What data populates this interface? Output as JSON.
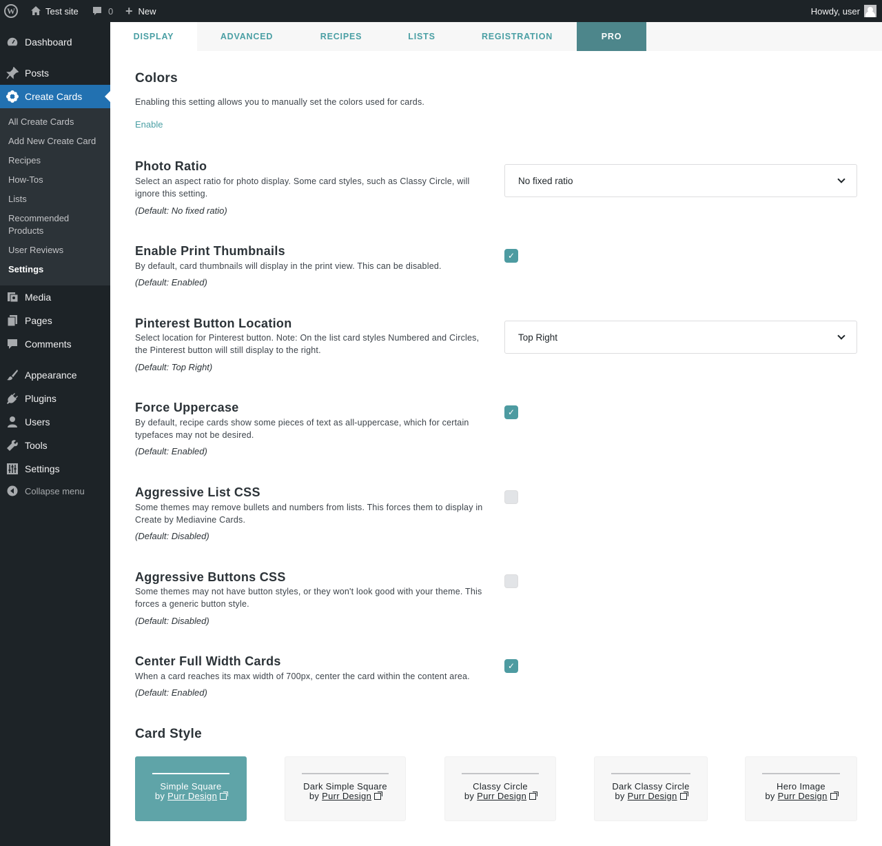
{
  "adminbar": {
    "site": "Test site",
    "comments_count": "0",
    "new": "New",
    "howdy": "Howdy, user"
  },
  "sidebar": {
    "items": [
      {
        "label": "Dashboard",
        "icon": "dashboard-icon"
      },
      {
        "label": "Posts",
        "icon": "pin-icon"
      },
      {
        "label": "Create Cards",
        "icon": "flower-icon"
      },
      {
        "label": "Media",
        "icon": "media-icon"
      },
      {
        "label": "Pages",
        "icon": "pages-icon"
      },
      {
        "label": "Comments",
        "icon": "comment-icon"
      },
      {
        "label": "Appearance",
        "icon": "brush-icon"
      },
      {
        "label": "Plugins",
        "icon": "plug-icon"
      },
      {
        "label": "Users",
        "icon": "user-icon"
      },
      {
        "label": "Tools",
        "icon": "wrench-icon"
      },
      {
        "label": "Settings",
        "icon": "sliders-icon"
      }
    ],
    "submenu": [
      "All Create Cards",
      "Add New Create Card",
      "Recipes",
      "How-Tos",
      "Lists",
      "Recommended Products",
      "User Reviews",
      "Settings"
    ],
    "collapse": "Collapse menu"
  },
  "tabs": [
    "DISPLAY",
    "ADVANCED",
    "RECIPES",
    "LISTS",
    "REGISTRATION",
    "PRO"
  ],
  "colors": {
    "title": "Colors",
    "desc": "Enabling this setting allows you to manually set the colors used for cards.",
    "link": "Enable"
  },
  "settings": {
    "photo_ratio": {
      "title": "Photo Ratio",
      "desc": "Select an aspect ratio for photo display. Some card styles, such as Classy Circle, will ignore this setting.",
      "default": "(Default: No fixed ratio)",
      "value": "No fixed ratio"
    },
    "print_thumbs": {
      "title": "Enable Print Thumbnails",
      "desc": "By default, card thumbnails will display in the print view. This can be disabled.",
      "default": "(Default: Enabled)",
      "checked": true
    },
    "pinterest": {
      "title": "Pinterest Button Location",
      "desc": "Select location for Pinterest button. Note: On the list card styles Numbered and Circles, the Pinterest button will still display to the right.",
      "default": "(Default: Top Right)",
      "value": "Top Right"
    },
    "uppercase": {
      "title": "Force Uppercase",
      "desc": "By default, recipe cards show some pieces of text as all-uppercase, which for certain typefaces may not be desired.",
      "default": "(Default: Enabled)",
      "checked": true
    },
    "list_css": {
      "title": "Aggressive List CSS",
      "desc": "Some themes may remove bullets and numbers from lists. This forces them to display in Create by Mediavine Cards.",
      "default": "(Default: Disabled)",
      "checked": false
    },
    "buttons_css": {
      "title": "Aggressive Buttons CSS",
      "desc": "Some themes may not have button styles, or they won't look good with your theme. This forces a generic button style.",
      "default": "(Default: Disabled)",
      "checked": false
    },
    "center_cards": {
      "title": "Center Full Width Cards",
      "desc": "When a card reaches its max width of 700px, center the card within the content area.",
      "default": "(Default: Enabled)",
      "checked": true
    }
  },
  "card_style": {
    "title": "Card Style",
    "by": "by",
    "author": "Purr Design",
    "cards": [
      "Simple Square",
      "Dark Simple Square",
      "Classy Circle",
      "Dark Classy Circle",
      "Hero Image"
    ],
    "selected": "Simple Square"
  },
  "colors_palette": {
    "accent": "#4a9fa4",
    "pro_tab": "#4d868b",
    "wp_blue": "#2271b1",
    "sidebar": "#1d2327"
  }
}
